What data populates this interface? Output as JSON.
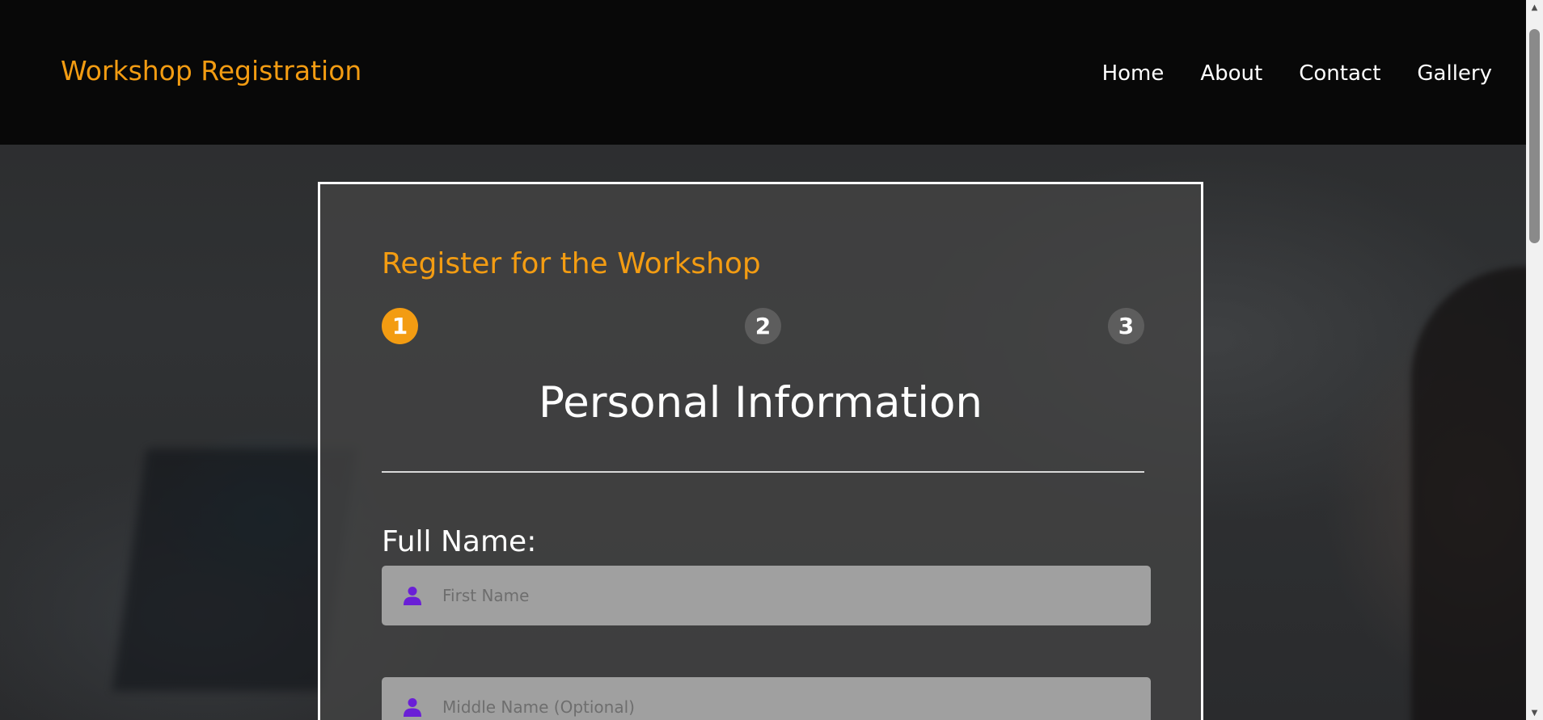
{
  "header": {
    "logo": "Workshop Registration",
    "nav": [
      "Home",
      "About",
      "Contact",
      "Gallery"
    ]
  },
  "form": {
    "title": "Register for the Workshop",
    "steps": [
      "1",
      "2",
      "3"
    ],
    "active_step": 1,
    "section_title": "Personal Information",
    "full_name_label": "Full Name:",
    "first_name_placeholder": "First Name",
    "middle_name_placeholder": "Middle Name (Optional)",
    "user_icon": "user-icon"
  },
  "colors": {
    "accent": "#f39c12",
    "icon": "#6a1fd6",
    "step_inactive": "#5d5d5d",
    "input_bg": "#a0a0a0"
  }
}
